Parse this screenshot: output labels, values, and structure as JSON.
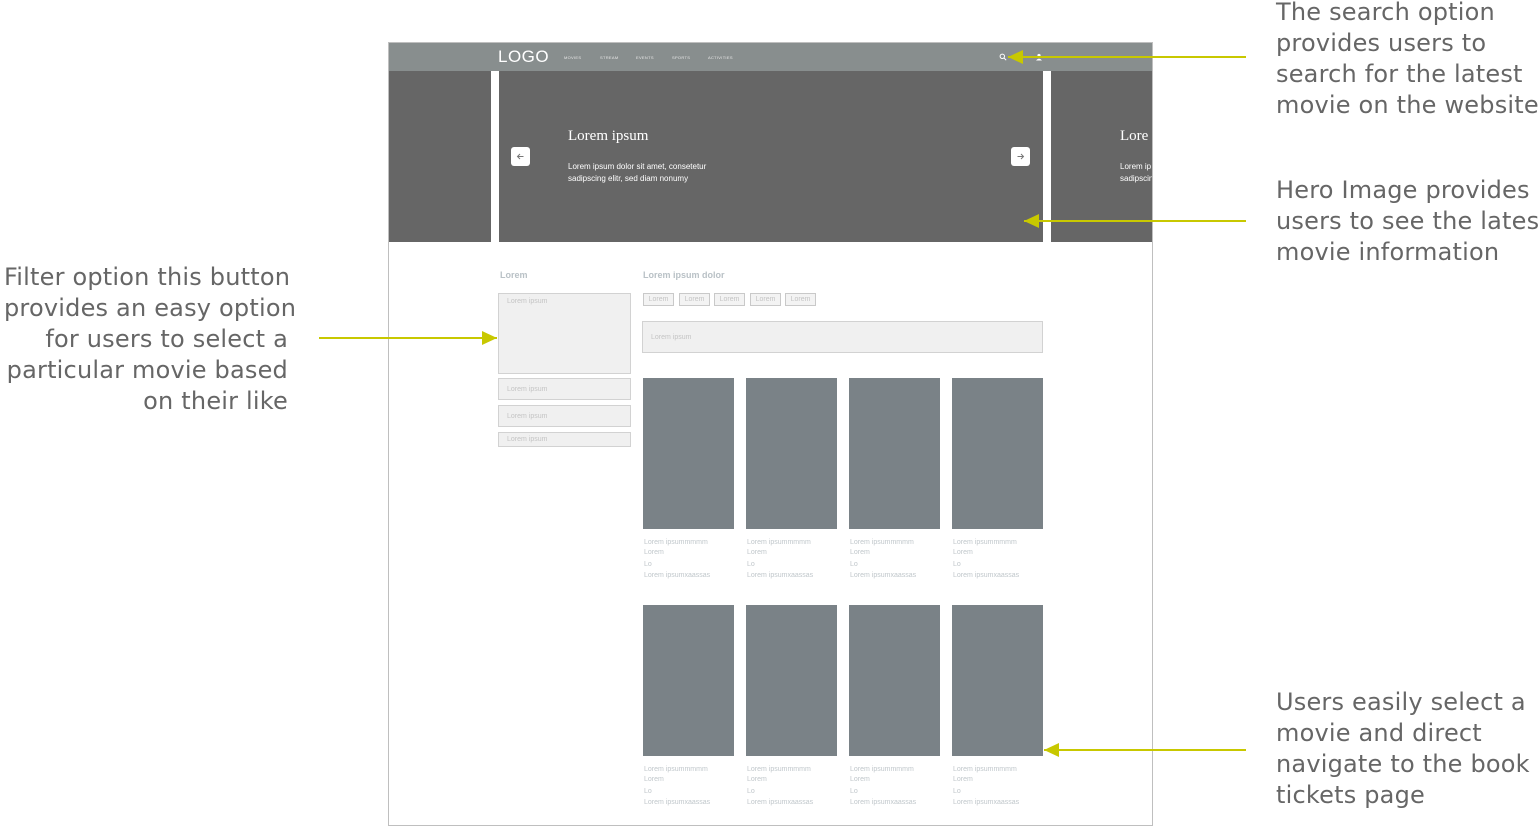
{
  "annotations": {
    "search": [
      "The search option",
      "provides users to",
      "search for the latest",
      "movie on the website"
    ],
    "hero": [
      "Hero Image provides",
      "users to see the latest",
      "movie information"
    ],
    "filter": [
      "Filter option this button",
      "provides an easy option",
      "for users to select a",
      "particular movie based",
      "on their like"
    ],
    "select": [
      "Users easily select a",
      "movie and direct",
      "navigate to the book",
      "tickets page"
    ]
  },
  "colors": {
    "arrow": "#c8c800",
    "nav_bg": "#888e8e",
    "hero_bg": "#666666",
    "card_bg": "#7a8287"
  },
  "wireframe": {
    "logo": "LOGO",
    "nav_items": [
      "MOVIES",
      "STREAM",
      "EVENTS",
      "SPORTS",
      "ACTIVITIES"
    ],
    "nav_icons": [
      "search-icon",
      "user-icon"
    ],
    "hero": {
      "title": "Lorem ipsum",
      "text_line1": "Lorem ipsum dolor sit amet, consetetur",
      "text_line2": "sadipscing elitr, sed diam nonumy",
      "peek_title": "Lore",
      "peek_line1": "Lorem ip",
      "peek_line2": "sadipscin",
      "prev_icon": "arrow-left-icon",
      "next_icon": "arrow-right-icon"
    },
    "filter_heading": "Lorem",
    "filter_items": [
      "Lorem ipsum",
      "Lorem ipsum",
      "Lorem ipsum",
      "Lorem ipsum"
    ],
    "content_heading": "Lorem ipsum dolor",
    "chips": [
      "Lorem",
      "Lorem",
      "Lorem",
      "Lorem",
      "Lorem"
    ],
    "search_placeholder": "Lorem ipsum",
    "card_lines": [
      "Lorem ipsummmmm",
      "Lorem",
      "Lo",
      "Lorem ipsumxaassas"
    ],
    "card_count": 8
  }
}
